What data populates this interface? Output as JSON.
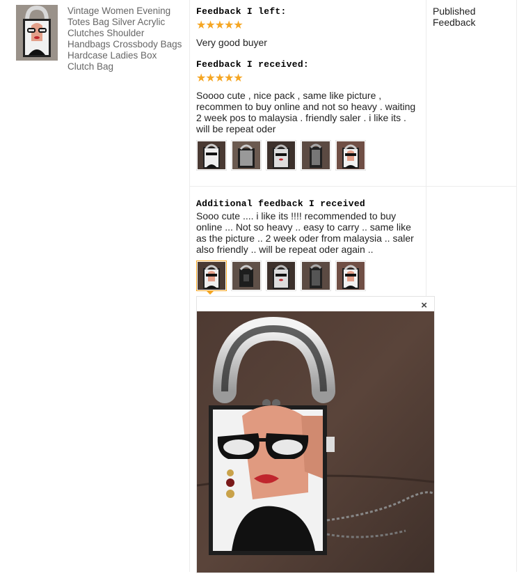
{
  "product": {
    "title": "Vintage Women Evening Totes Bag Silver Acrylic Clutches Shoulder Handbags Crossbody Bags Hardcase Ladies Box Clutch Bag"
  },
  "feedback_left": {
    "heading": "Feedback I left:",
    "rating": 5,
    "stars": "★★★★★",
    "text": "Very good buyer"
  },
  "feedback_received": {
    "heading": "Feedback I received:",
    "rating": 5,
    "stars": "★★★★★",
    "text": "Soooo cute , nice pack , same like picture , recommen to buy online and not so heavy . waiting 2 week pos to malaysia . friendly saler . i like its . will be repeat oder"
  },
  "additional_feedback": {
    "heading": "Additional feedback I received",
    "text": "Sooo cute .... i like its !!!! recommended to buy online ... Not so heavy .. easy to carry .. same like as the picture .. 2 week oder from malaysia .. saler also friendly .. will be repeat oder again .."
  },
  "status": {
    "published": "Published Feedback"
  },
  "viewer": {
    "close_symbol": "×"
  },
  "colors": {
    "star": "#f5a623",
    "border": "#ececec"
  }
}
